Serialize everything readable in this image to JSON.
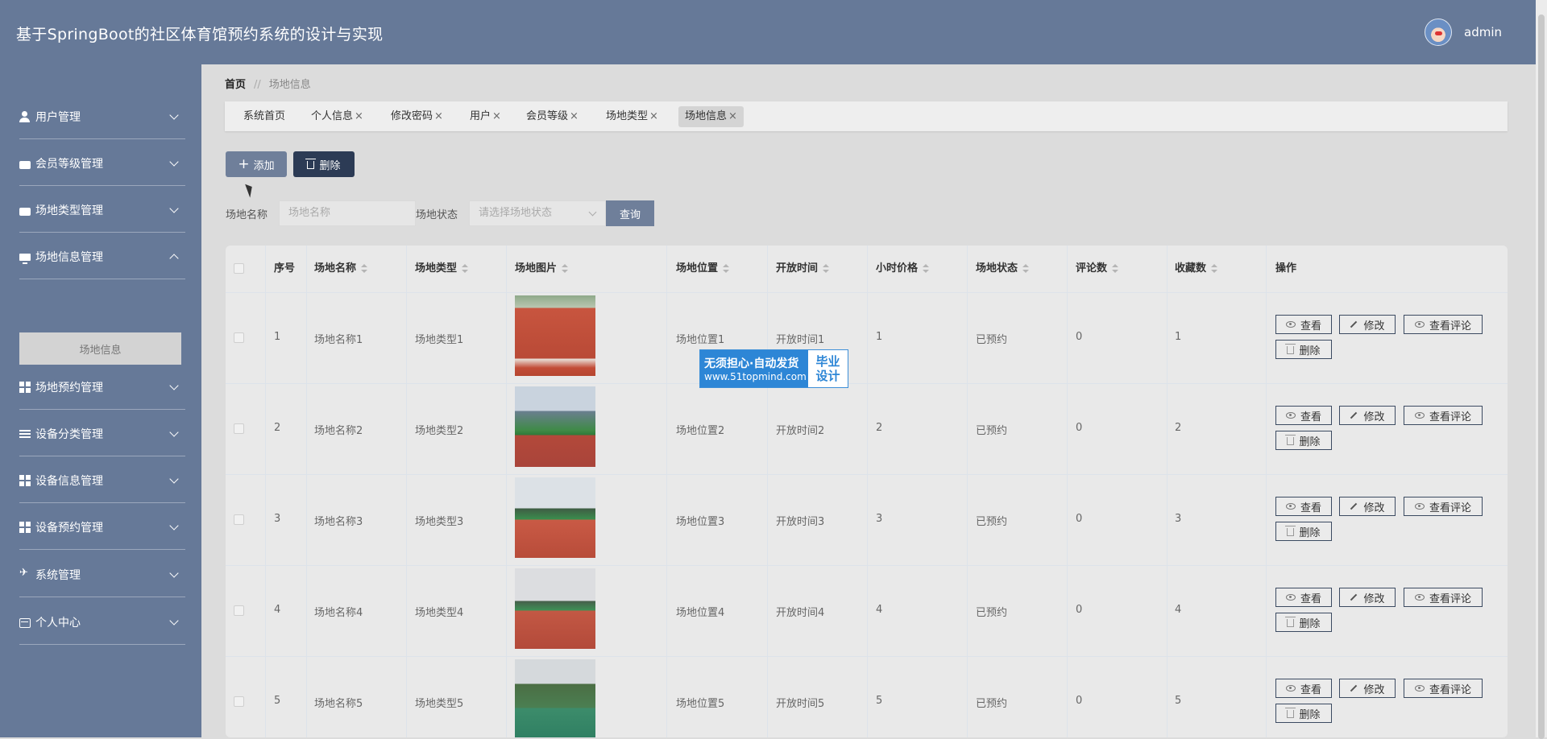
{
  "app": {
    "title": "基于SpringBoot的社区体育馆预约系统的设计与实现",
    "user": "admin"
  },
  "sidebar": {
    "items": [
      {
        "label": "用户管理",
        "icon": "user-icon"
      },
      {
        "label": "会员等级管理",
        "icon": "medal-icon"
      },
      {
        "label": "场地类型管理",
        "icon": "folder-icon"
      },
      {
        "label": "场地信息管理",
        "icon": "monitor-icon"
      },
      {
        "label": "场地预约管理",
        "icon": "grid-icon"
      },
      {
        "label": "设备分类管理",
        "icon": "list-icon"
      },
      {
        "label": "设备信息管理",
        "icon": "grid-icon"
      },
      {
        "label": "设备预约管理",
        "icon": "grid-icon"
      },
      {
        "label": "系统管理",
        "icon": "send-icon"
      },
      {
        "label": "个人中心",
        "icon": "card-icon"
      }
    ],
    "submenu_active": "场地信息"
  },
  "breadcrumb": {
    "home": "首页",
    "separator": "//",
    "current": "场地信息"
  },
  "tabs": [
    {
      "label": "系统首页",
      "closable": false
    },
    {
      "label": "个人信息",
      "closable": true
    },
    {
      "label": "修改密码",
      "closable": true
    },
    {
      "label": "用户",
      "closable": true
    },
    {
      "label": "会员等级",
      "closable": true
    },
    {
      "label": "场地类型",
      "closable": true
    },
    {
      "label": "场地信息",
      "closable": true
    }
  ],
  "tab_close": "×",
  "toolbar": {
    "add_label": "添加",
    "delete_label": "删除"
  },
  "search": {
    "name_label": "场地名称",
    "name_placeholder": "场地名称",
    "status_label": "场地状态",
    "status_placeholder": "请选择场地状态",
    "query_label": "查询"
  },
  "table": {
    "headers": [
      "序号",
      "场地名称",
      "场地类型",
      "场地图片",
      "场地位置",
      "开放时间",
      "小时价格",
      "场地状态",
      "评论数",
      "收藏数",
      "操作"
    ],
    "rows": [
      {
        "no": "1",
        "name": "场地名称1",
        "type": "场地类型1",
        "location": "场地位置1",
        "open_time": "开放时间1",
        "price": "1",
        "status": "已预约",
        "comments": "0",
        "favorites": "1"
      },
      {
        "no": "2",
        "name": "场地名称2",
        "type": "场地类型2",
        "location": "场地位置2",
        "open_time": "开放时间2",
        "price": "2",
        "status": "已预约",
        "comments": "0",
        "favorites": "2"
      },
      {
        "no": "3",
        "name": "场地名称3",
        "type": "场地类型3",
        "location": "场地位置3",
        "open_time": "开放时间3",
        "price": "3",
        "status": "已预约",
        "comments": "0",
        "favorites": "3"
      },
      {
        "no": "4",
        "name": "场地名称4",
        "type": "场地类型4",
        "location": "场地位置4",
        "open_time": "开放时间4",
        "price": "4",
        "status": "已预约",
        "comments": "0",
        "favorites": "4"
      },
      {
        "no": "5",
        "name": "场地名称5",
        "type": "场地类型5",
        "location": "场地位置5",
        "open_time": "开放时间5",
        "price": "5",
        "status": "已预约",
        "comments": "0",
        "favorites": "5"
      }
    ],
    "actions": {
      "view": "查看",
      "edit": "修改",
      "view_comments": "查看评论",
      "delete": "删除"
    }
  },
  "watermark": {
    "line1": "无须担心·自动发货",
    "line2": "www.51topmind.com",
    "badge1": "毕业",
    "badge2": "设计"
  },
  "colors": {
    "header": "#667998",
    "sidebar": "#667998",
    "primary_button": "#6f7f9a",
    "delete_button": "#2c3b55",
    "watermark": "#2d86d6"
  }
}
